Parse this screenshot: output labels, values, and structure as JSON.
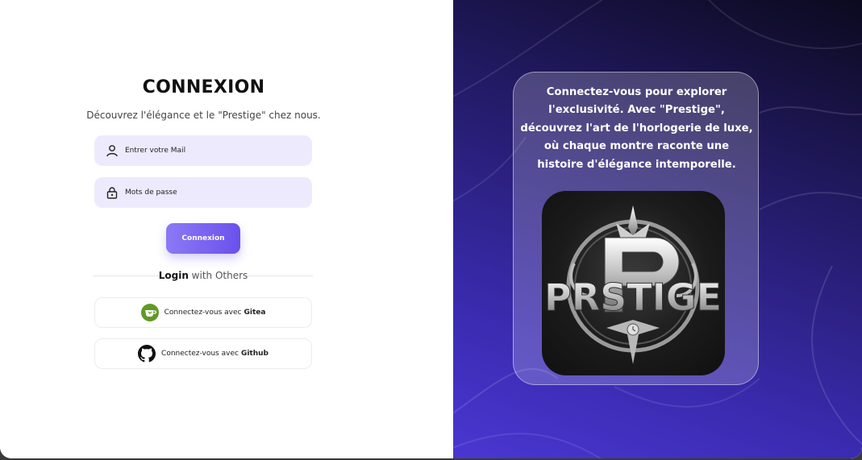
{
  "login": {
    "title": "CONNEXION",
    "subtitle": "Découvrez l'élégance et le \"Prestige\" chez nous.",
    "email_placeholder": "Entrer votre Mail",
    "password_placeholder": "Mots de passe",
    "submit_label": "Connexion",
    "divider_bold": "Login",
    "divider_rest": " with Others",
    "social": [
      {
        "prefix": "Connectez-vous avec",
        "provider": "Gitea",
        "icon": "gitea-icon"
      },
      {
        "prefix": "Connectez-vous avec",
        "provider": "Github",
        "icon": "github-icon"
      }
    ]
  },
  "promo": {
    "text": "Connectez-vous pour explorer l'exclusivité. Avec \"Prestige\", découvrez l'art de l'horlogerie de luxe, où chaque montre raconte une histoire d'élégance intemporelle.",
    "logo_text": "PRSTIGE"
  },
  "colors": {
    "accent": "#6b51ec",
    "field_bg": "#eeeafd",
    "panel_dark": "#0b0a1e",
    "panel_light": "#4a37d2"
  }
}
